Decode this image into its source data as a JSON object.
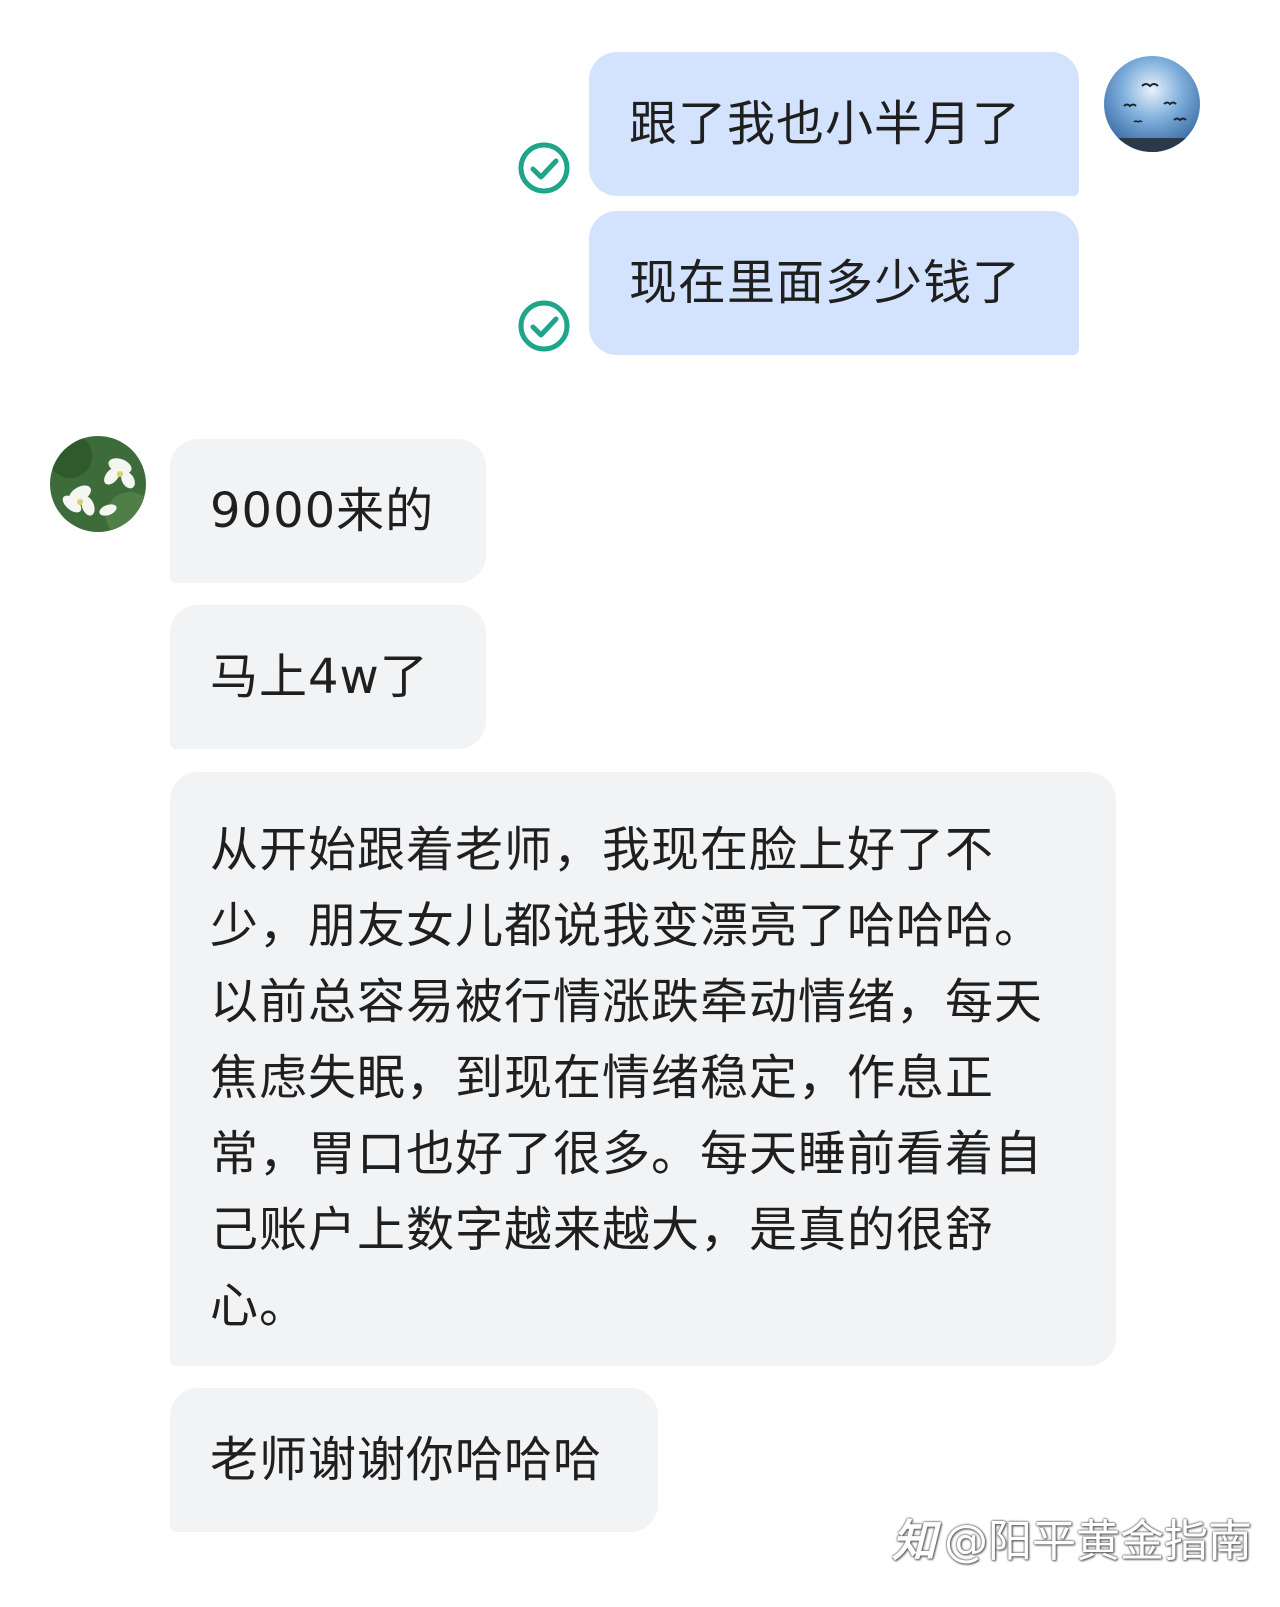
{
  "chat": {
    "outgoing": [
      {
        "text": "跟了我也小半月了",
        "status_icon": "check-circle-icon"
      },
      {
        "text": "现在里面多少钱了",
        "status_icon": "check-circle-icon"
      }
    ],
    "incoming": [
      {
        "text": "9000来的"
      },
      {
        "text": "马上4w了"
      },
      {
        "lines": [
          "从开始跟着老师，我现在脸上好了不",
          "少，朋友女儿都说我变漂亮了哈哈哈。",
          "以前总容易被行情涨跌牵动情绪，每天",
          "焦虑失眠，到现在情绪稳定，作息正",
          "常，胃口也好了很多。每天睡前看着自",
          "己账户上数字越来越大，是真的很舒",
          "心。"
        ]
      },
      {
        "text": "老师谢谢你哈哈哈"
      }
    ]
  },
  "avatars": {
    "self": "sky-birds-avatar",
    "contact": "white-flowers-avatar"
  },
  "colors": {
    "outgoing_bubble": "#d3e3fd",
    "incoming_bubble": "#f2f3f5",
    "check": "#1fa58a"
  },
  "watermark": {
    "logo": "知",
    "text": "@阳平黄金指南"
  }
}
